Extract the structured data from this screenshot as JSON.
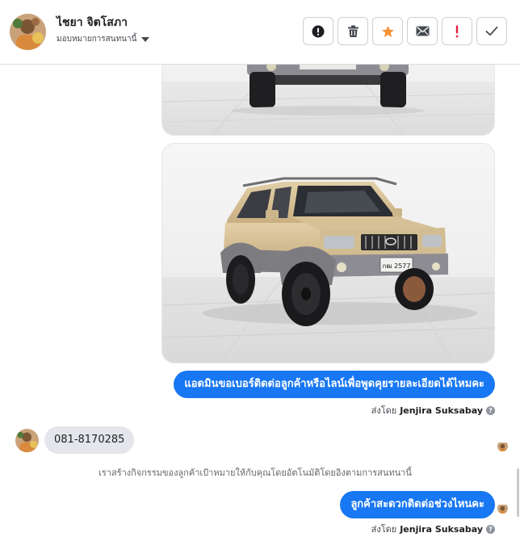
{
  "contact": {
    "name": "ไชยา จิตโสภา",
    "assign_label": "มอบหมายการสนทนานี้"
  },
  "toolbar": {
    "actions": [
      {
        "name": "report-button",
        "icon": "exclamation-circle-icon"
      },
      {
        "name": "delete-button",
        "icon": "trash-icon"
      },
      {
        "name": "star-button",
        "icon": "star-icon"
      },
      {
        "name": "mark-unread-button",
        "icon": "envelope-icon"
      },
      {
        "name": "flag-button",
        "icon": "exclamation-icon"
      },
      {
        "name": "done-button",
        "icon": "check-icon"
      }
    ],
    "colors": {
      "star": "#f7923a",
      "flag": "#e41e3f",
      "icon": "#444950"
    }
  },
  "thread": {
    "messages": [
      {
        "type": "outgoing",
        "text": "แอดมินขอเบอร์ติดต่อลูกค้าหรือไลน์เพื่อพูดคุยรายละเอียดได้ไหมคะ",
        "sent_by_prefix": "ส่งโดย",
        "agent": "Jenjira Suksabay"
      },
      {
        "type": "incoming",
        "text": "081-8170285"
      },
      {
        "type": "system",
        "text": "เราสร้างกิจกรรมของลูกค้าเป้าหมายให้กับคุณโดยอัตโนมัติโดยอิงตามการสนทนานี้"
      },
      {
        "type": "outgoing",
        "text": "ลูกค้าสะดวกติดต่อช่วงไหนคะ",
        "sent_by_prefix": "ส่งโดย",
        "agent": "Jenjira Suksabay"
      }
    ],
    "plate_text": "กฒ 2577",
    "colors": {
      "outgoing_bubble": "#1877f2",
      "incoming_bubble": "#e4e6eb"
    }
  }
}
